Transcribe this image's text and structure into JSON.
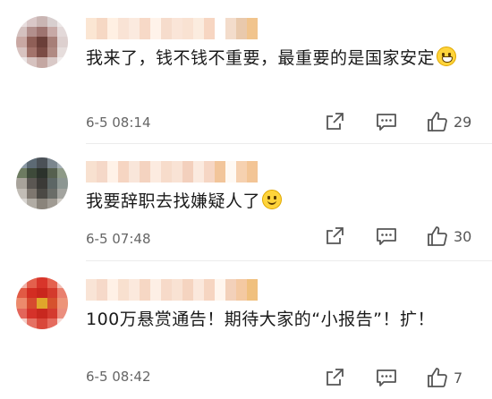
{
  "comments": [
    {
      "text": "我来了，钱不钱不重要，最重要的是国家安定",
      "emoji": "grinning-emoji",
      "date": "6-5 08:14",
      "likes": "29",
      "avatar_colors": [
        "#e8dede",
        "#d9c7c7",
        "#c9b5b3",
        "#d8cfcf",
        "#ece7e7",
        "#d4c1bf",
        "#b28f8c",
        "#9e7470",
        "#c7a9a6",
        "#e3d9d9",
        "#c9a8a3",
        "#8f5f57",
        "#6b3f39",
        "#a77f78",
        "#ddd0cf",
        "#d8c3c0",
        "#a3736b",
        "#7b4c45",
        "#b08a83",
        "#e6dddc",
        "#ece6e6",
        "#d6c2bf",
        "#c4a7a2",
        "#d9c9c7",
        "#f1eded"
      ],
      "name_colors": [
        "#fbe6d3",
        "#f6d8c4",
        "#fff0e3",
        "#f9e3d5",
        "#fbeadf",
        "#f7d9c7",
        "#fff3ea",
        "#f6dccc",
        "#fae5d8",
        "#f9e2d2",
        "#fbecdf",
        "#f7d6c2",
        "#ffffff",
        "#f3dccb",
        "#e9c9ac",
        "#f1c48d"
      ]
    },
    {
      "text": "我要辞职去找嫌疑人了",
      "emoji": "smiling-emoji",
      "date": "6-5 07:48",
      "likes": "30",
      "avatar_colors": [
        "#8c9aa6",
        "#5d6a74",
        "#4b5157",
        "#7b868e",
        "#a7b1b8",
        "#6d7b61",
        "#3e4a3a",
        "#2c332c",
        "#56604f",
        "#8e9a87",
        "#a8a39b",
        "#5b5753",
        "#3b3a37",
        "#5c6665",
        "#8c9692",
        "#c2bdb6",
        "#7e776f",
        "#4c4a45",
        "#6a6d68",
        "#a3a49f",
        "#d9d6d2",
        "#b1aca4",
        "#8a847b",
        "#a09b93",
        "#cfcbc5"
      ],
      "name_colors": [
        "#f8e1d0",
        "#f5d8c8",
        "#fff2e8",
        "#f6d5c2",
        "#f9e6da",
        "#f4d3c0",
        "#fcebe0",
        "#f7dccb",
        "#f9e3d5",
        "#f3d0bd",
        "#fbeadf",
        "#f6d6c4",
        "#f2c59a",
        "#fff9f3",
        "#f6d1b0",
        "#f3c596"
      ]
    },
    {
      "text": "100万悬赏通告！期待大家的“小报告”！扩！",
      "emoji": "",
      "date": "6-5 08:42",
      "likes": "7",
      "avatar_colors": [
        "#f2b3a8",
        "#e3604d",
        "#d8352a",
        "#e4624f",
        "#f3c0b6",
        "#e15a44",
        "#d32d22",
        "#c9261d",
        "#d43a2c",
        "#e9806e",
        "#ec8a6c",
        "#d64a2f",
        "#e0a62b",
        "#d6522d",
        "#ed9479",
        "#e3655a",
        "#d5322a",
        "#c8281f",
        "#d43b2f",
        "#eb8e7e",
        "#f5cfc8",
        "#e57163",
        "#d9473a",
        "#e56b5e",
        "#f7d8d2"
      ],
      "name_colors": [
        "#f9e4d6",
        "#f6d9c9",
        "#fff1e6",
        "#f8e0cf",
        "#fbe9dd",
        "#f6d7c4",
        "#fdefe5",
        "#f7dac9",
        "#f9e2d3",
        "#f5d4c0",
        "#fbe8dc",
        "#f6d5c1",
        "#fff6ee",
        "#f3d1ba",
        "#f4c9a2",
        "#f0c07e"
      ]
    }
  ],
  "icons": {
    "share": "share-icon",
    "reply": "comment-icon",
    "like": "thumbs-up-icon"
  }
}
